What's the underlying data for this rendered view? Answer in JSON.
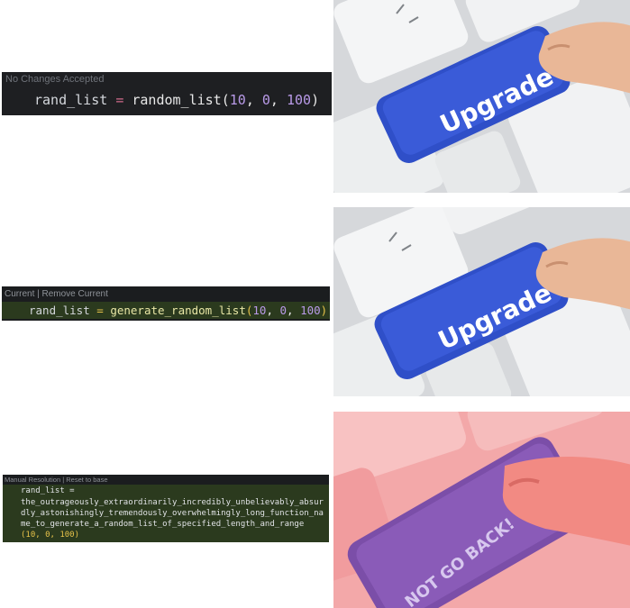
{
  "panels": [
    {
      "header": "No Changes Accepted",
      "code": {
        "var": "rand_list",
        "op": "=",
        "fn": "random_list",
        "open": "(",
        "a1": "10",
        "c1": ", ",
        "a2": "0",
        "c2": ", ",
        "a3": "100",
        "close": ")"
      }
    },
    {
      "header": "Current | Remove Current",
      "code": {
        "var": "rand_list",
        "op": "=",
        "fn": "generate_random_list",
        "open": "(",
        "a1": "10",
        "c1": ", ",
        "a2": "0",
        "c2": ", ",
        "a3": "100",
        "close": ")"
      }
    },
    {
      "header": "Manual Resolution | Reset to base",
      "lines": [
        "rand_list =",
        "the_outrageously_extraordinarily_incredibly_unbelievably_absur",
        "dly_astonishingly_tremendously_overwhelmingly_long_function_na",
        "me_to_generate_a_random_list_of_specified_length_and_range",
        "(10, 0, 100)"
      ]
    }
  ],
  "photos": [
    {
      "key_label": "Upgrade",
      "key_color": "#3a5bd8"
    },
    {
      "key_label": "Upgrade",
      "key_color": "#3a5bd8"
    },
    {
      "key_label": "NOT GO BACK!",
      "key_color": "#8a5bb8"
    }
  ]
}
